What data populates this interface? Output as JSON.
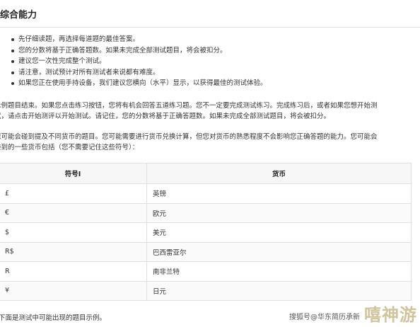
{
  "title": "综合能力",
  "bullets": [
    "先仔细读题，再选择每道题的最佳答案。",
    "您的分数将基于正确答题数。如果未完成全部测试题目，将会被扣分。",
    "建议您一次性完成整个测试。",
    "请注意，测试预计对所有测试者来说都有难度。",
    "如果您正在使用手持设备，我们建议您横向（水平）显示，以获得最佳的测试体验。"
  ],
  "paragraph1": [
    "示例题目结束。如果您点击练习按钮，您将有机会回答五道练习题。您不一定要完成测试练习。完成练习后，或者如果您想开始测",
    "试，请点击开始测评以开始测试。请记住，您的分数将基于正确答题数。如果未完成全部测试题目，将会被扣分。"
  ],
  "paragraph2": [
    "您可能会碰到提及不同货币的题目。您可能需要进行货币兑换计算，但您对货币的熟悉程度不会影响您正确答题的能力。您可能会",
    "碰到的一些货币包括（您不需要记住这些符号）："
  ],
  "table": {
    "headers": [
      "符号I",
      "货币"
    ],
    "rows": [
      [
        "£",
        "英镑"
      ],
      [
        "€",
        "欧元"
      ],
      [
        "$",
        "美元"
      ],
      [
        "R$",
        "巴西雷亚尔"
      ],
      [
        "R",
        "南非兰特"
      ],
      [
        "¥",
        "日元"
      ]
    ]
  },
  "footer": "下面是测试中可能出现的题目示例。",
  "watermark": {
    "small": "搜狐号@华东简历承新",
    "big": "嘻神游"
  }
}
